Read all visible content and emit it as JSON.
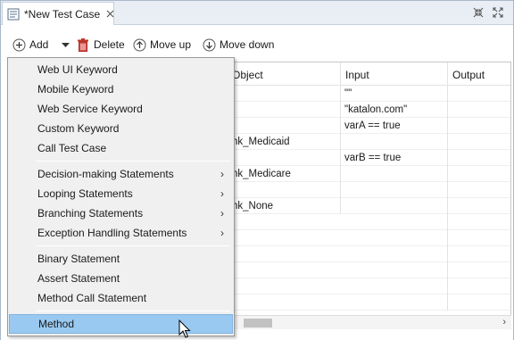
{
  "tab": {
    "title": "*New Test Case"
  },
  "toolbar": {
    "add_label": "Add",
    "delete_label": "Delete",
    "move_up_label": "Move up",
    "move_down_label": "Move down"
  },
  "table": {
    "columns": [
      "Object",
      "Input",
      "Output"
    ],
    "rows": [
      {
        "object": "",
        "input": "\"\"",
        "output": ""
      },
      {
        "object": "",
        "input": "",
        "output": ""
      },
      {
        "object": "",
        "input": "\"katalon.com\"",
        "output": ""
      },
      {
        "object": "",
        "input": "varA == true",
        "output": ""
      },
      {
        "object": "hk_Medicaid",
        "input": "",
        "output": ""
      },
      {
        "object": "",
        "input": "varB == true",
        "output": ""
      },
      {
        "object": "hk_Medicare",
        "input": "",
        "output": ""
      },
      {
        "object": "",
        "input": "",
        "output": ""
      },
      {
        "object": "hk_None",
        "input": "",
        "output": ""
      }
    ]
  },
  "menu": {
    "group1": [
      "Web UI Keyword",
      "Mobile Keyword",
      "Web Service Keyword",
      "Custom Keyword",
      "Call Test Case"
    ],
    "group2": [
      "Decision-making Statements",
      "Looping Statements",
      "Branching Statements",
      "Exception Handling Statements"
    ],
    "group3": [
      "Binary Statement",
      "Assert Statement",
      "Method Call Statement"
    ],
    "group4": [
      "Method"
    ],
    "selected": "Method"
  },
  "colors": {
    "selection": "#99c9f0",
    "delete_icon": "#c0392b",
    "tab_bar": "#e9eef5"
  }
}
